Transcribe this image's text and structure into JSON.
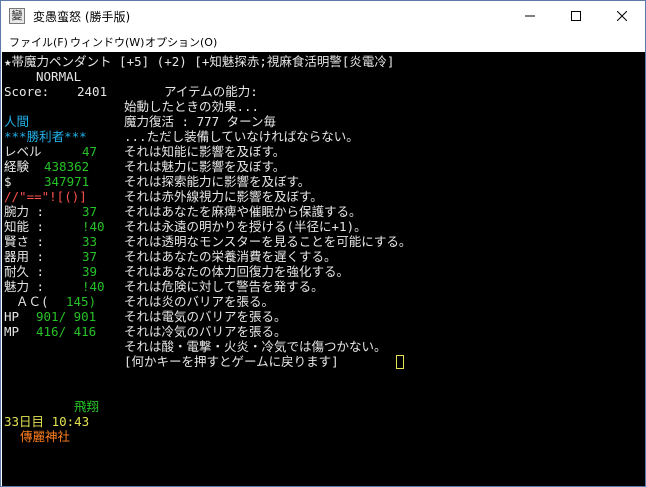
{
  "window": {
    "icon_glyph": "變",
    "title": "変愚蛮怒 (勝手版)"
  },
  "menu": {
    "file": "ファイル(F)",
    "window": "ウィンドウ(W)",
    "options": "オプション(O)"
  },
  "item": {
    "name": "★帯魔力ペンダント [+5] (+2) [+知魅探赤;視麻食活明警[炎電冷]"
  },
  "stats": {
    "difficulty": "NORMAL",
    "score_label": "Score:",
    "score_value": "2401",
    "race": "人間",
    "title": "***勝利者***",
    "level_label": "レベル",
    "level_value": "47",
    "exp_label": "経験",
    "exp_value": "438362",
    "gold_label": "$",
    "gold_value": "347971",
    "equip_chars": "//\"==\"![()]",
    "str_label": "腕力 :",
    "str_value": "37",
    "int_label": "知能 :",
    "int_value": "!40",
    "wis_label": "賢さ :",
    "wis_value": "33",
    "dex_label": "器用 :",
    "dex_value": "37",
    "con_label": "耐久 :",
    "con_value": "39",
    "chr_label": "魅力 :",
    "chr_value": "!40",
    "ac_label": "ＡＣ(",
    "ac_value": "145)",
    "hp_label": "HP",
    "hp_value": "901/ 901",
    "mp_label": "MP",
    "mp_value": "416/ 416",
    "status_flying": "飛翔",
    "day_time": "33日目 10:43",
    "location": "傳麗神社"
  },
  "description": {
    "header": "アイテムの能力:",
    "lines": [
      "始動したときの効果...",
      "魔力復活 : 777 ターン毎",
      "...ただし装備していなければならない。",
      "それは知能に影響を及ぼす。",
      "それは魅力に影響を及ぼす。",
      "それは探索能力に影響を及ぼす。",
      "それは赤外線視力に影響を及ぼす。",
      "それはあなたを麻痺や催眠から保護する。",
      "それは永遠の明かりを授ける(半径に+1)。",
      "それは透明なモンスターを見ることを可能にする。",
      "それはあなたの栄養消費を遅くする。",
      "それはあなたの体力回復力を強化する。",
      "それは危険に対して警告を発する。",
      "それは炎のバリアを張る。",
      "それは電気のバリアを張る。",
      "それは冷気のバリアを張る。",
      "それは酸・電撃・火炎・冷気では傷つかない。"
    ],
    "prompt": "[何かキーを押すとゲームに戻ります]"
  },
  "colors": {
    "terminal_bg": "#000000",
    "text_white": "#e6e6e6",
    "text_cyan": "#22b0e8",
    "text_green": "#27c227",
    "text_yellow": "#e2e252",
    "text_orange": "#ff7e1e",
    "text_red": "#ff5050"
  }
}
